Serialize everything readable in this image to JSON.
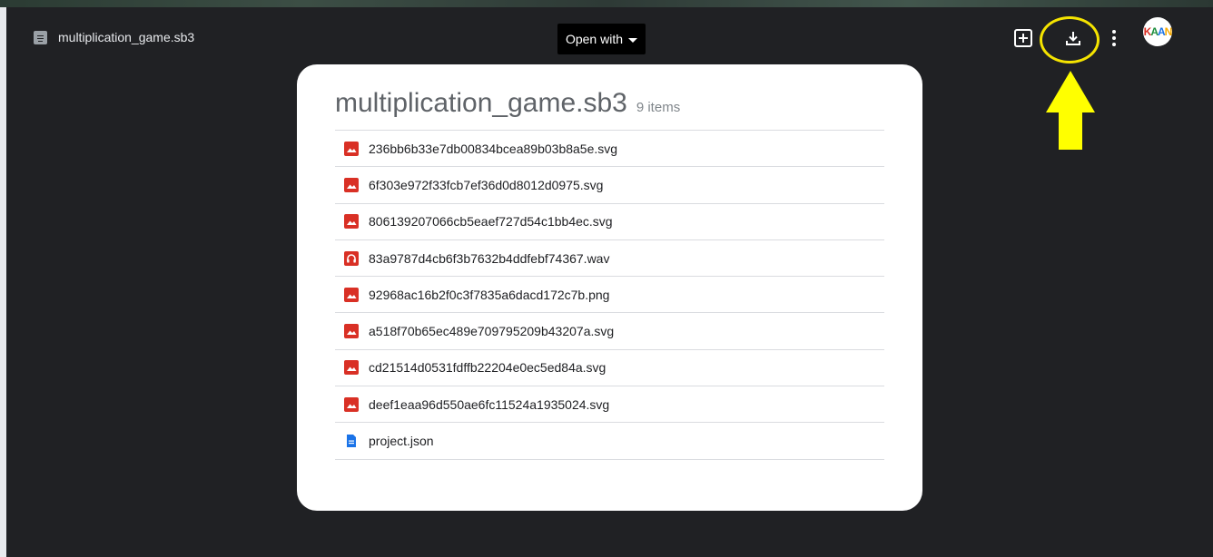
{
  "header": {
    "file_name": "multiplication_game.sb3",
    "open_with_label": "Open with"
  },
  "toolbar": {
    "icons": [
      "add-to-drive-icon",
      "download-icon",
      "more-vert-icon"
    ],
    "avatar_text": "KAAN"
  },
  "annotation": {
    "circle_color": "#f5e400",
    "arrow_color": "#ffff00"
  },
  "archive": {
    "title": "multiplication_game.sb3",
    "count": "9 items",
    "files": [
      {
        "name": "236bb6b33e7db00834bcea89b03b8a5e.svg",
        "type": "image"
      },
      {
        "name": "6f303e972f33fcb7ef36d0d8012d0975.svg",
        "type": "image"
      },
      {
        "name": "806139207066cb5eaef727d54c1bb4ec.svg",
        "type": "image"
      },
      {
        "name": "83a9787d4cb6f3b7632b4ddfebf74367.wav",
        "type": "audio"
      },
      {
        "name": "92968ac16b2f0c3f7835a6dacd172c7b.png",
        "type": "image"
      },
      {
        "name": "a518f70b65ec489e709795209b43207a.svg",
        "type": "image"
      },
      {
        "name": "cd21514d0531fdffb22204e0ec5ed84a.svg",
        "type": "image"
      },
      {
        "name": "deef1eaa96d550ae6fc11524a1935024.svg",
        "type": "image"
      },
      {
        "name": "project.json",
        "type": "doc"
      }
    ]
  },
  "colors": {
    "background": "#202124",
    "image_icon": "#d93025",
    "doc_icon": "#1a73e8"
  }
}
